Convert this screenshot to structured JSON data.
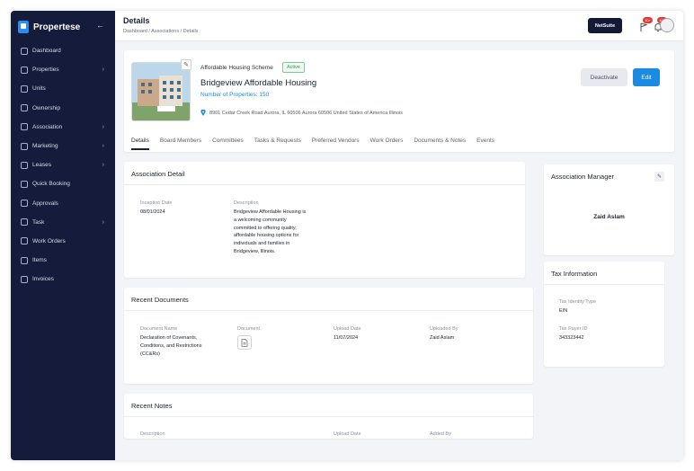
{
  "brand": {
    "name": "Propertese"
  },
  "sidebar": {
    "items": [
      {
        "label": "Dashboard",
        "icon": "dashboard-icon",
        "chevron": false
      },
      {
        "label": "Properties",
        "icon": "building-icon",
        "chevron": true
      },
      {
        "label": "Units",
        "icon": "grid-icon",
        "chevron": false
      },
      {
        "label": "Ownership",
        "icon": "handshake-icon",
        "chevron": false
      },
      {
        "label": "Association",
        "icon": "document-icon",
        "chevron": true
      },
      {
        "label": "Marketing",
        "icon": "megaphone-icon",
        "chevron": true
      },
      {
        "label": "Leases",
        "icon": "file-icon",
        "chevron": true
      },
      {
        "label": "Quick Booking",
        "icon": "bell-booking-icon",
        "chevron": false
      },
      {
        "label": "Approvals",
        "icon": "clipboard-icon",
        "chevron": false
      },
      {
        "label": "Task",
        "icon": "task-icon",
        "chevron": true
      },
      {
        "label": "Work Orders",
        "icon": "layers-icon",
        "chevron": false
      },
      {
        "label": "Items",
        "icon": "list-icon",
        "chevron": false
      },
      {
        "label": "Invoices",
        "icon": "invoice-icon",
        "chevron": false
      }
    ]
  },
  "header": {
    "title": "Details",
    "breadcrumb": "Dashboard / Associations / Details",
    "netsuite_label": "NetSuite",
    "notif_badge_1": "10+",
    "notif_badge_2": "10+"
  },
  "association": {
    "scheme": "Affordable Housing Scheme",
    "status": "Active",
    "name": "Bridgeview Affordable Housing",
    "properties_count": "Number of Properties: 150",
    "address": "8901 Cedar Creek Road Aurora, IL 60506 Aurora 60506 United States of America Illinois",
    "deactivate_label": "Deactivate",
    "edit_label": "Edit"
  },
  "tabs": [
    "Details",
    "Board Members",
    "Committees",
    "Tasks & Requests",
    "Preferred Vendors",
    "Work Orders",
    "Documents & Notes",
    "Events"
  ],
  "association_detail": {
    "title": "Association Detail",
    "inception_label": "Inception Date",
    "inception_value": "08/01/2024",
    "description_label": "Description",
    "description_lines": [
      "Bridgeview Affordable Housing is",
      "a welcoming community",
      "committed to offering quality,",
      "affordable housing options for",
      "individuals and families in",
      "Bridgeview, Illinois."
    ]
  },
  "recent_documents": {
    "title": "Recent Documents",
    "col_name": "Document Name",
    "col_doc": "Document",
    "col_date": "Upload Date",
    "col_by": "Uploaded By",
    "row": {
      "name_lines": [
        "Declaration of Covenants,",
        "Conditions, and Restrictions",
        "(CC&Rs)"
      ],
      "date": "11/07/2024",
      "by": "Zaid Aslam"
    }
  },
  "recent_notes": {
    "title": "Recent Notes",
    "col_desc": "Description",
    "col_date": "Upload Date",
    "col_by": "Added By"
  },
  "association_manager": {
    "title": "Association Manager",
    "name": "Zaid Aslam"
  },
  "tax_information": {
    "title": "Tax Information",
    "id_type_label": "Tax Identity Type",
    "id_type_value": "EIN",
    "payer_id_label": "Tax Payer ID",
    "payer_id_value": "343323442"
  },
  "colors": {
    "sidebar": "#141b3b",
    "accent": "#1a8be0",
    "active_status": "#2e9e4f"
  }
}
